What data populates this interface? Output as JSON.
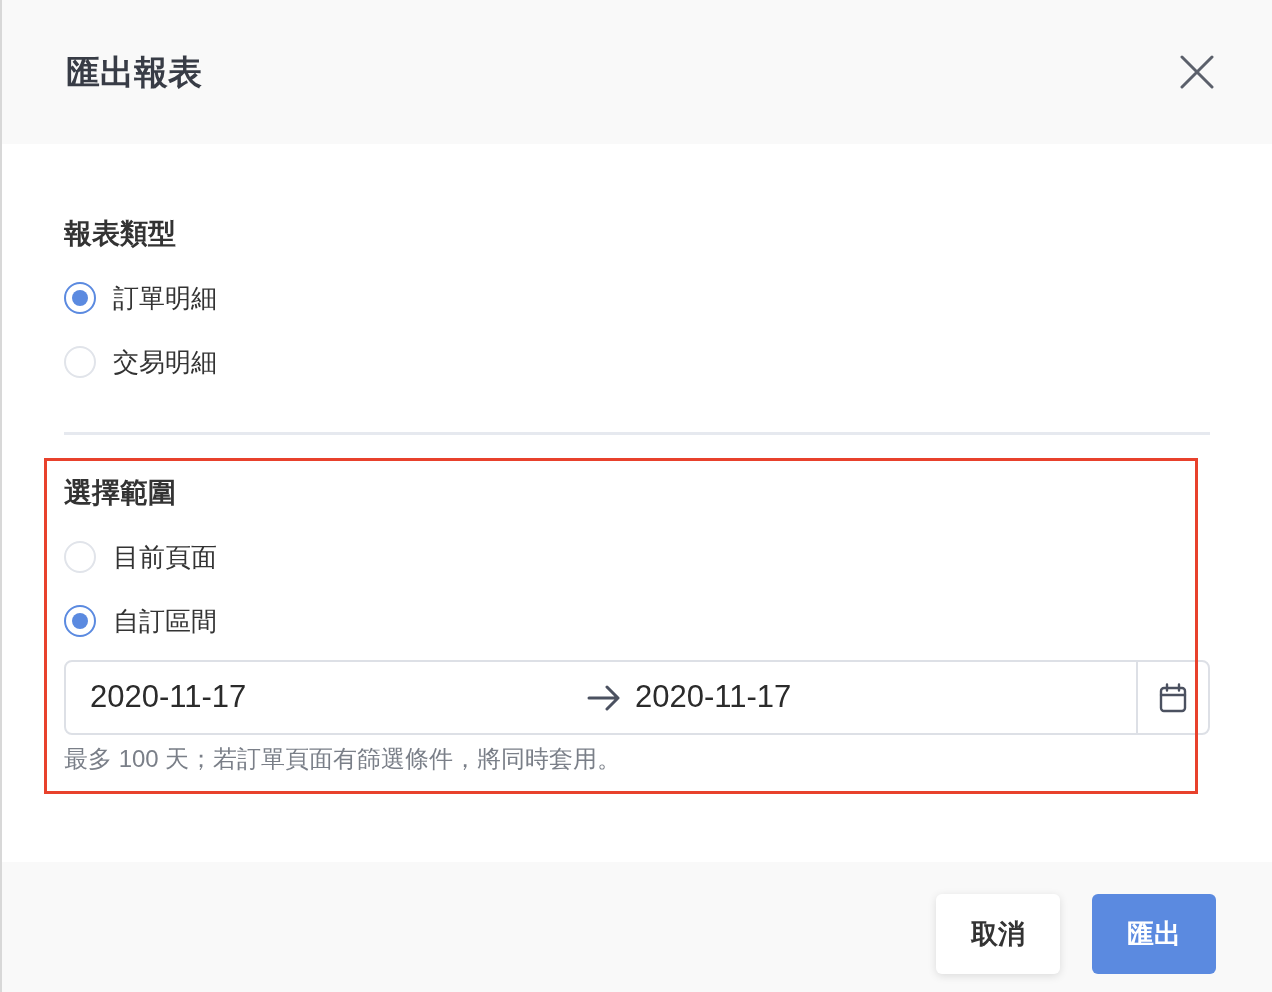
{
  "dialog": {
    "title": "匯出報表"
  },
  "sections": [
    {
      "title": "報表類型",
      "options": [
        {
          "label": "訂單明細",
          "selected": true
        },
        {
          "label": "交易明細",
          "selected": false
        }
      ]
    },
    {
      "title": "選擇範圍",
      "highlighted": true,
      "options": [
        {
          "label": "目前頁面",
          "selected": false
        },
        {
          "label": "自訂區間",
          "selected": true
        }
      ],
      "date_range": {
        "start": "2020-11-17",
        "end": "2020-11-17"
      },
      "help": "最多 100 天；若訂單頁面有篩選條件，將同時套用。"
    }
  ],
  "buttons": [
    {
      "label": "取消",
      "kind": "secondary"
    },
    {
      "label": "匯出",
      "kind": "primary"
    }
  ]
}
